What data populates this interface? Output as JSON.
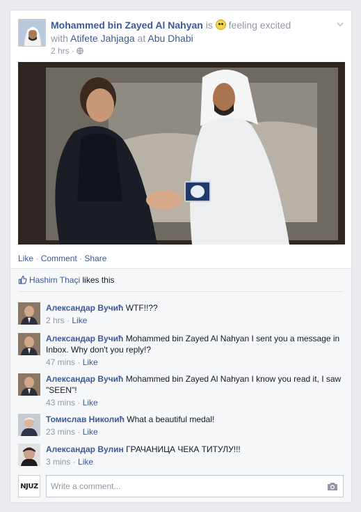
{
  "post": {
    "author": "Mohammed bin Zayed Al Nahyan",
    "is_text": "is",
    "feeling_text": "feeling excited",
    "with_text": "with",
    "tagged_person": "Atifete Jahjaga",
    "at_text": "at",
    "location": "Abu Dhabi",
    "time": "2 hrs",
    "privacy_icon": "globe-icon"
  },
  "actions": {
    "like": "Like",
    "comment": "Comment",
    "share": "Share",
    "separator": " · "
  },
  "likes": {
    "name": "Hashim Thaçi",
    "suffix": "likes this"
  },
  "comments": [
    {
      "author": "Александар Вучић",
      "text": "WTF!!??",
      "time": "2 hrs",
      "like": "Like"
    },
    {
      "author": "Александар Вучић",
      "text": "Mohammed bin Zayed Al Nahyan I sent you a message in Inbox. Why don't you reply!?",
      "time": "47 mins",
      "like": "Like"
    },
    {
      "author": "Александар Вучић",
      "text": "Mohammed bin Zayed Al Nahyan I know you read it, I saw \"SEEN\"!",
      "time": "43 mins",
      "like": "Like"
    },
    {
      "author": "Томислав Николић",
      "text": "What a beautiful medal!",
      "time": "23 mins",
      "like": "Like"
    },
    {
      "author": "Александар Вулин",
      "text": "ГРАЧАНИЦА ЧЕКА ТИТУЛУ!!!",
      "time": "3 mins",
      "like": "Like"
    }
  ],
  "composer": {
    "placeholder": "Write a comment...",
    "page_logo": "NJUZ"
  },
  "colors": {
    "link": "#3b5998",
    "muted": "#9197a3",
    "feedback_bg": "#f6f7f9"
  }
}
